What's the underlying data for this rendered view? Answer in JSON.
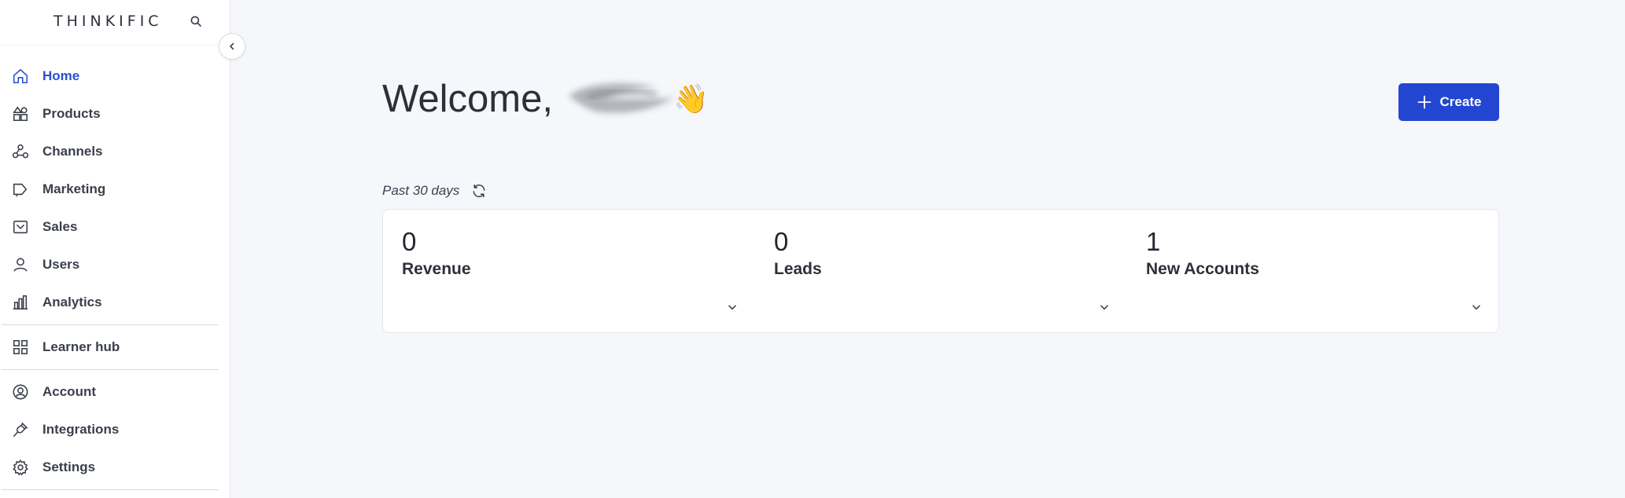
{
  "brand": {
    "logo": "THINKIFIC",
    "search_icon": "search-icon"
  },
  "sidebar": {
    "collapse_icon": "chevron-left-icon",
    "items": [
      {
        "label": "Home",
        "icon": "home-icon",
        "active": true
      },
      {
        "label": "Products",
        "icon": "products-icon"
      },
      {
        "label": "Channels",
        "icon": "channels-icon"
      },
      {
        "label": "Marketing",
        "icon": "marketing-icon"
      },
      {
        "label": "Sales",
        "icon": "sales-icon"
      },
      {
        "label": "Users",
        "icon": "user-icon"
      },
      {
        "label": "Analytics",
        "icon": "analytics-icon"
      },
      {
        "label": "Learner hub",
        "icon": "grid-icon"
      },
      {
        "label": "Account",
        "icon": "account-icon"
      },
      {
        "label": "Integrations",
        "icon": "plug-icon"
      },
      {
        "label": "Settings",
        "icon": "gear-icon"
      }
    ]
  },
  "main": {
    "welcome": "Welcome,",
    "wave": "👋",
    "create_button": "Create",
    "period": "Past 30 days",
    "stats": [
      {
        "value": "0",
        "label": "Revenue"
      },
      {
        "value": "0",
        "label": "Leads"
      },
      {
        "value": "1",
        "label": "New Accounts"
      }
    ]
  },
  "colors": {
    "accent": "#2346d2",
    "active_nav": "#2b4fd1",
    "background": "#f6f7fb"
  }
}
